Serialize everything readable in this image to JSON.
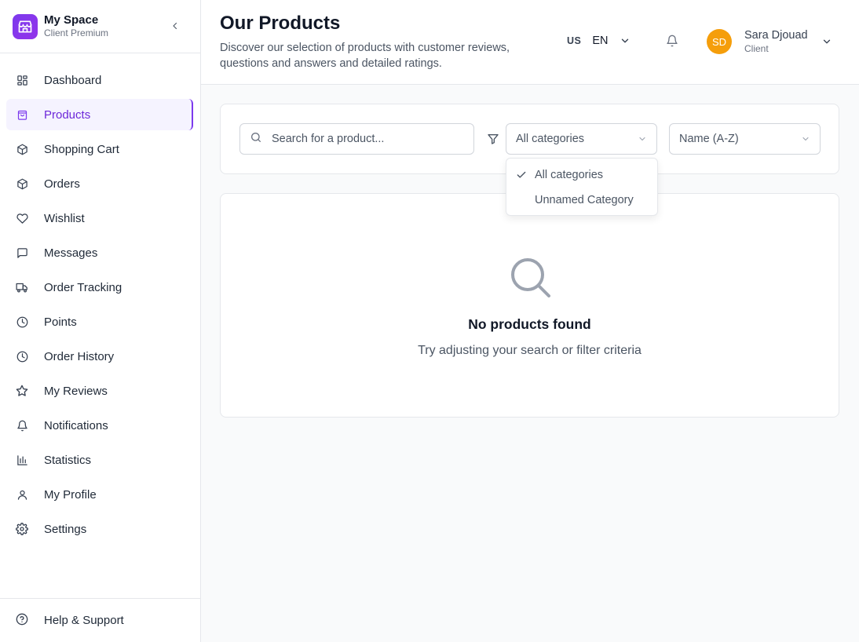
{
  "brand": {
    "name": "My Space",
    "subtitle": "Client Premium",
    "accent": "#7c3aed"
  },
  "sidebar": {
    "items": [
      {
        "label": "Dashboard",
        "icon": "dashboard-icon"
      },
      {
        "label": "Products",
        "icon": "shopping-bag-icon",
        "active": true
      },
      {
        "label": "Shopping Cart",
        "icon": "package-icon"
      },
      {
        "label": "Orders",
        "icon": "package-icon"
      },
      {
        "label": "Wishlist",
        "icon": "heart-icon"
      },
      {
        "label": "Messages",
        "icon": "message-icon"
      },
      {
        "label": "Order Tracking",
        "icon": "truck-icon"
      },
      {
        "label": "Points",
        "icon": "clock-icon"
      },
      {
        "label": "Order History",
        "icon": "clock-icon"
      },
      {
        "label": "My Reviews",
        "icon": "star-icon"
      },
      {
        "label": "Notifications",
        "icon": "bell-icon"
      },
      {
        "label": "Statistics",
        "icon": "bar-chart-icon"
      },
      {
        "label": "My Profile",
        "icon": "user-icon"
      },
      {
        "label": "Settings",
        "icon": "gear-icon"
      }
    ],
    "help_label": "Help & Support"
  },
  "header": {
    "title": "Our Products",
    "subtitle": "Discover our selection of products with customer reviews, questions and answers and detailed ratings.",
    "lang_flag": "US",
    "lang_code": "EN",
    "user": {
      "initials": "SD",
      "name": "Sara Djouad",
      "role": "Client",
      "avatar_color": "#f59e0b"
    }
  },
  "filters": {
    "search_placeholder": "Search for a product...",
    "category_selected": "All categories",
    "sort_selected": "Name (A-Z)",
    "category_options": [
      {
        "label": "All categories",
        "checked": true
      },
      {
        "label": "Unnamed Category",
        "checked": false
      }
    ]
  },
  "empty_state": {
    "title": "No products found",
    "subtitle": "Try adjusting your search or filter criteria"
  }
}
